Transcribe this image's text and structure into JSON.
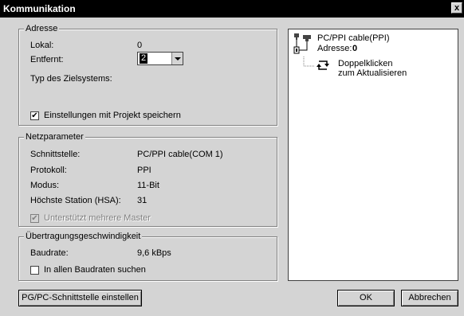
{
  "window": {
    "title": "Kommunikation",
    "close_glyph": "x"
  },
  "adresse": {
    "legend": "Adresse",
    "lokal_label": "Lokal:",
    "lokal_value": "0",
    "entfernt_label": "Entfernt:",
    "entfernt_value": "2",
    "typ_label": "Typ des Zielsystems:",
    "save_settings_label": "Einstellungen mit Projekt speichern",
    "save_settings_checked": true
  },
  "netzparameter": {
    "legend": "Netzparameter",
    "rows": [
      {
        "label": "Schnittstelle:",
        "value": "PC/PPI cable(COM 1)"
      },
      {
        "label": "Protokoll:",
        "value": "PPI"
      },
      {
        "label": "Modus:",
        "value": "11-Bit"
      },
      {
        "label": "Höchste Station (HSA):",
        "value": "31"
      }
    ],
    "multi_master_label": "Unterstützt mehrere Master",
    "multi_master_checked": true,
    "multi_master_enabled": false
  },
  "uebertragung": {
    "legend": "Übertragungsgeschwindigkeit",
    "baudrate_label": "Baudrate:",
    "baudrate_value": "9,6 kBps",
    "search_all_label": "In allen Baudraten suchen",
    "search_all_checked": false
  },
  "tree": {
    "cable_label": "PC/PPI cable(PPI)",
    "address_label": "Adresse:",
    "address_value": "0",
    "refresh_line1": "Doppelklicken",
    "refresh_line2": "zum Aktualisieren",
    "cable_icon": "pc-ppi-cable-icon",
    "refresh_icon": "refresh-icon"
  },
  "buttons": {
    "interface_label": "PG/PC-Schnittstelle einstellen",
    "ok_label": "OK",
    "cancel_label": "Abbrechen"
  }
}
